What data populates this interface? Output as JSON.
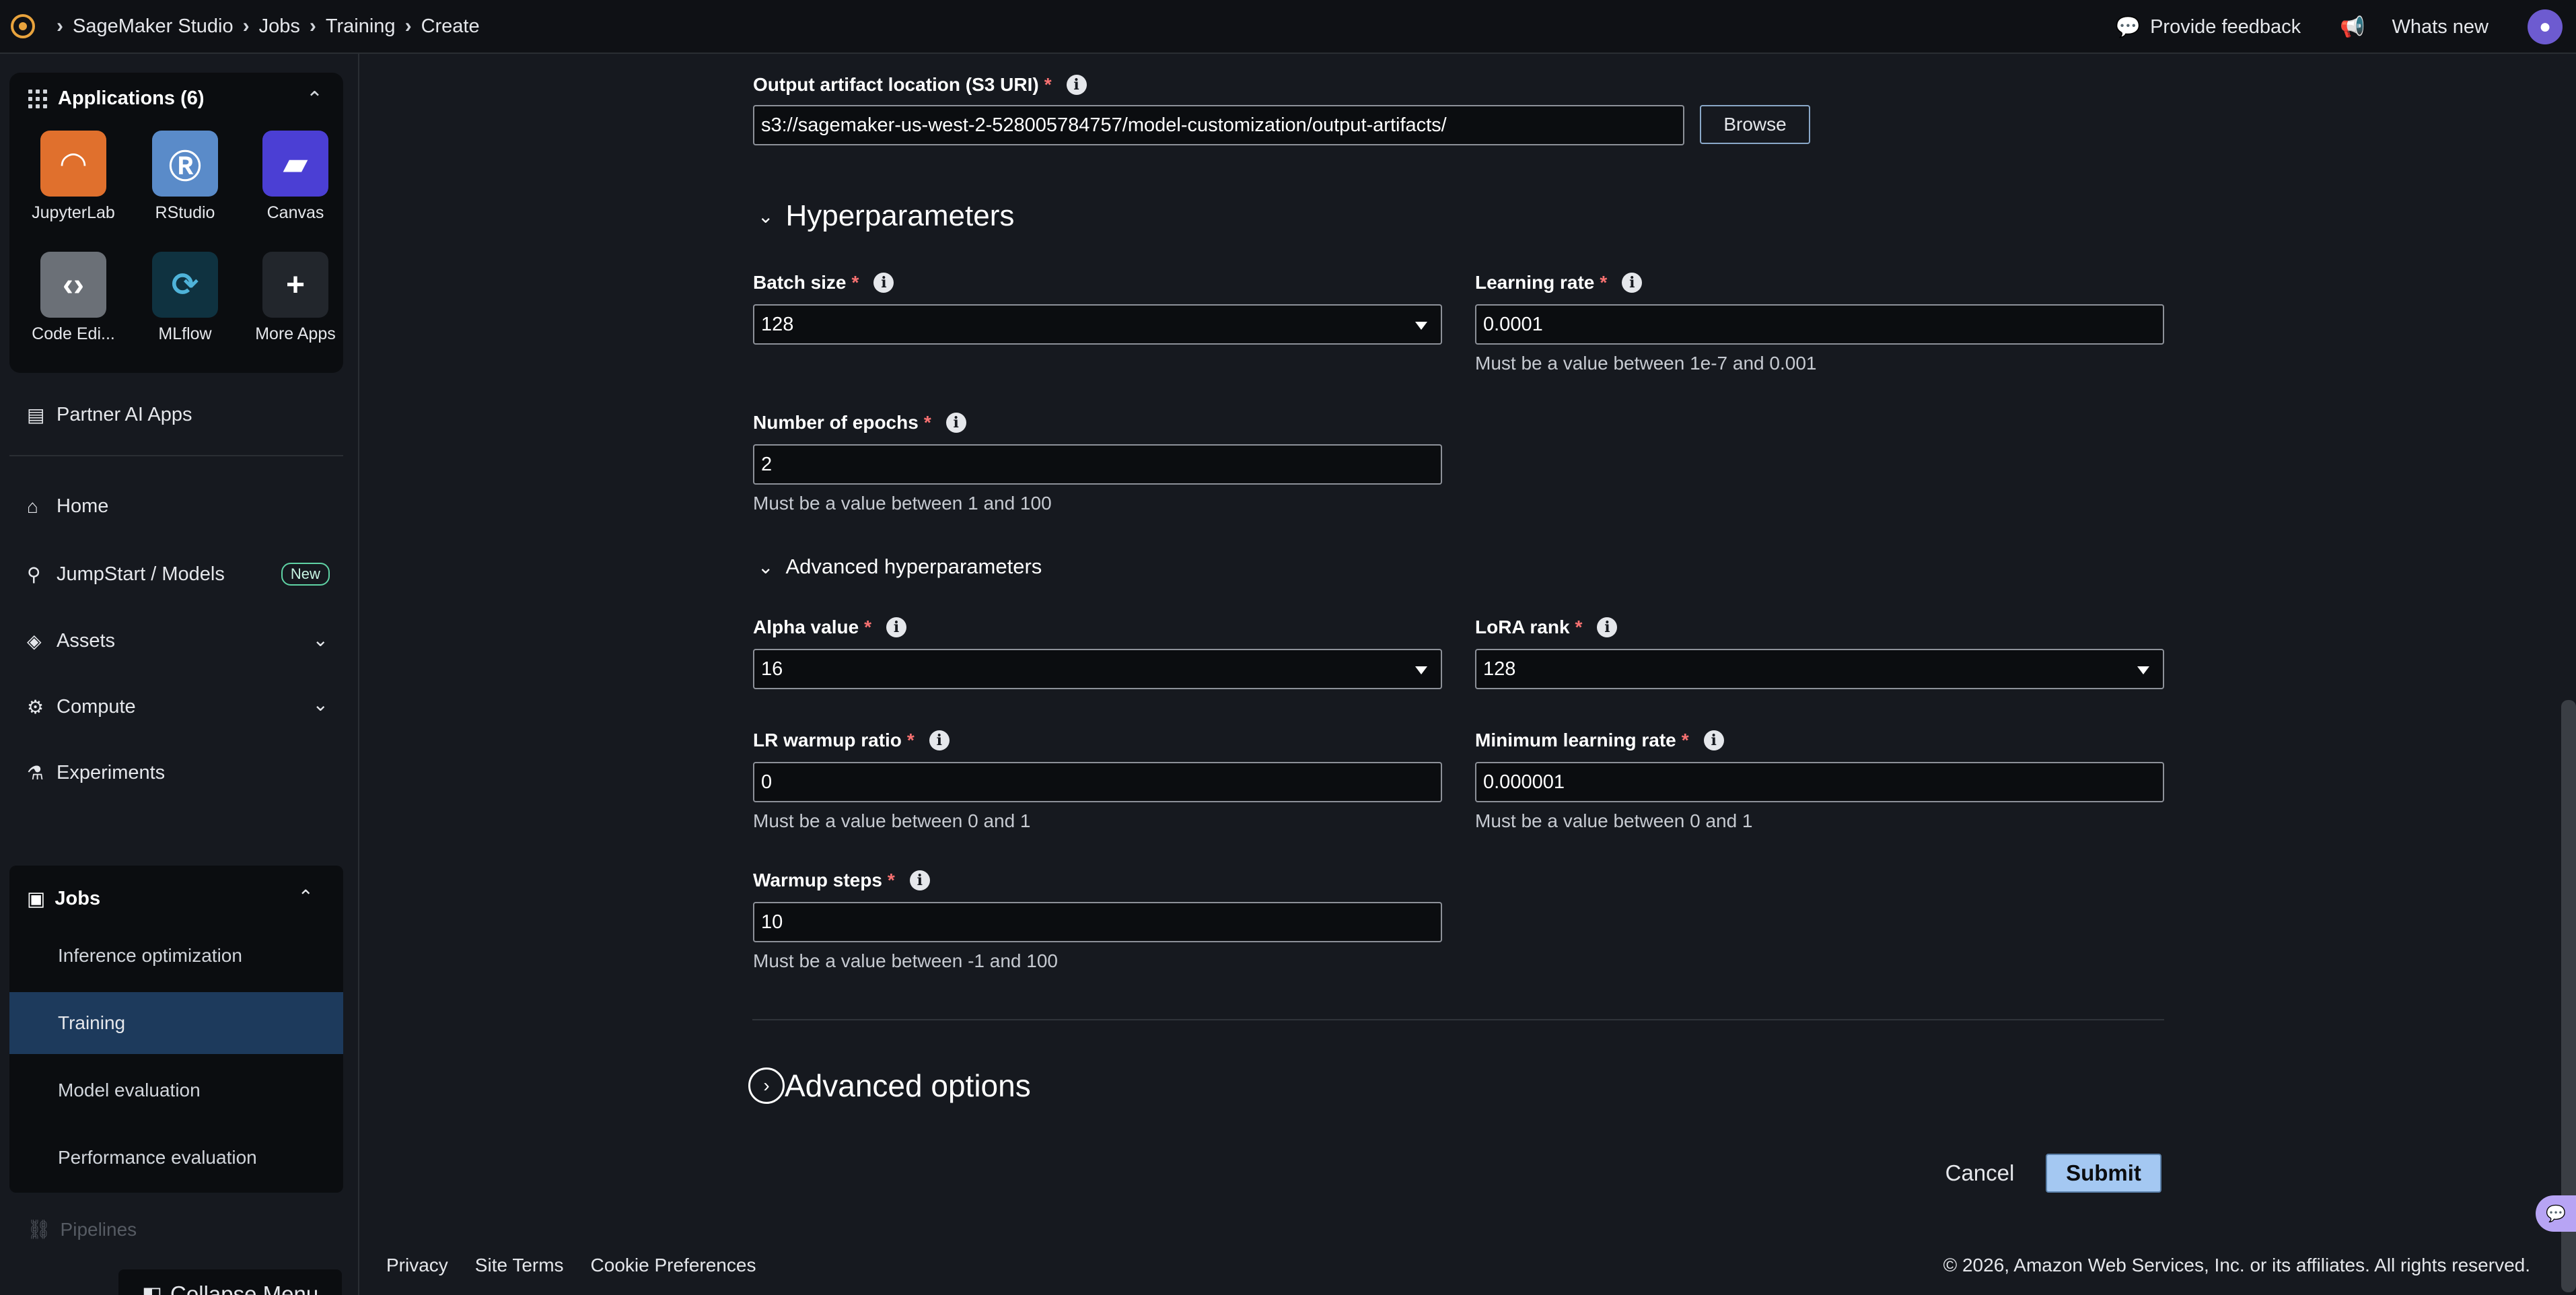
{
  "breadcrumb": {
    "items": [
      "SageMaker Studio",
      "Jobs",
      "Training",
      "Create"
    ]
  },
  "header": {
    "feedback_label": "Provide feedback",
    "whats_new_label": "Whats new"
  },
  "sidebar": {
    "applications_title": "Applications (6)",
    "apps": [
      {
        "label": "JupyterLab",
        "icon": "jupyterlab-icon",
        "color": "#e0702d"
      },
      {
        "label": "RStudio",
        "icon": "rstudio-icon",
        "color": "#5a8bc9"
      },
      {
        "label": "Canvas",
        "icon": "canvas-icon",
        "color": "#4b3fd4"
      },
      {
        "label": "Code Edi...",
        "icon": "code-editor-icon",
        "color": "#6b7077"
      },
      {
        "label": "MLflow",
        "icon": "mlflow-icon",
        "color": "#0f3240"
      },
      {
        "label": "More Apps",
        "icon": "plus-icon",
        "color": "#22262c"
      }
    ],
    "partner_label": "Partner AI Apps",
    "home_label": "Home",
    "jumpstart_label": "JumpStart / Models",
    "new_badge": "New",
    "assets_label": "Assets",
    "compute_label": "Compute",
    "experiments_label": "Experiments",
    "jobs_label": "Jobs",
    "jobs_items": [
      "Inference optimization",
      "Training",
      "Model evaluation",
      "Performance evaluation"
    ],
    "pipelines_label": "Pipelines",
    "collapse_label": "Collapse Menu"
  },
  "form": {
    "output_label": "Output artifact location (S3 URI)",
    "output_value": "s3://sagemaker-us-west-2-528005784757/model-customization/output-artifacts/",
    "browse_label": "Browse",
    "hyperparameters_title": "Hyperparameters",
    "batch_size_label": "Batch size",
    "batch_size_value": "128",
    "learning_rate_label": "Learning rate",
    "learning_rate_value": "0.0001",
    "learning_rate_hint": "Must be a value between 1e-7 and 0.001",
    "epochs_label": "Number of epochs",
    "epochs_value": "2",
    "epochs_hint": "Must be a value between 1 and 100",
    "advanced_hyper_title": "Advanced hyperparameters",
    "alpha_label": "Alpha value",
    "alpha_value": "16",
    "lora_label": "LoRA rank",
    "lora_value": "128",
    "lr_warmup_label": "LR warmup ratio",
    "lr_warmup_value": "0",
    "lr_warmup_hint": "Must be a value between 0 and 1",
    "min_lr_label": "Minimum learning rate",
    "min_lr_value": "0.000001",
    "min_lr_hint": "Must be a value between 0 and 1",
    "warmup_steps_label": "Warmup steps",
    "warmup_steps_value": "10",
    "warmup_steps_hint": "Must be a value between -1 and 100",
    "advanced_options_title": "Advanced options",
    "cancel_label": "Cancel",
    "submit_label": "Submit",
    "required_mark": "*"
  },
  "footer": {
    "privacy": "Privacy",
    "site_terms": "Site Terms",
    "cookie_prefs": "Cookie Preferences",
    "copyright": "© 2026, Amazon Web Services, Inc. or its affiliates. All rights reserved."
  }
}
